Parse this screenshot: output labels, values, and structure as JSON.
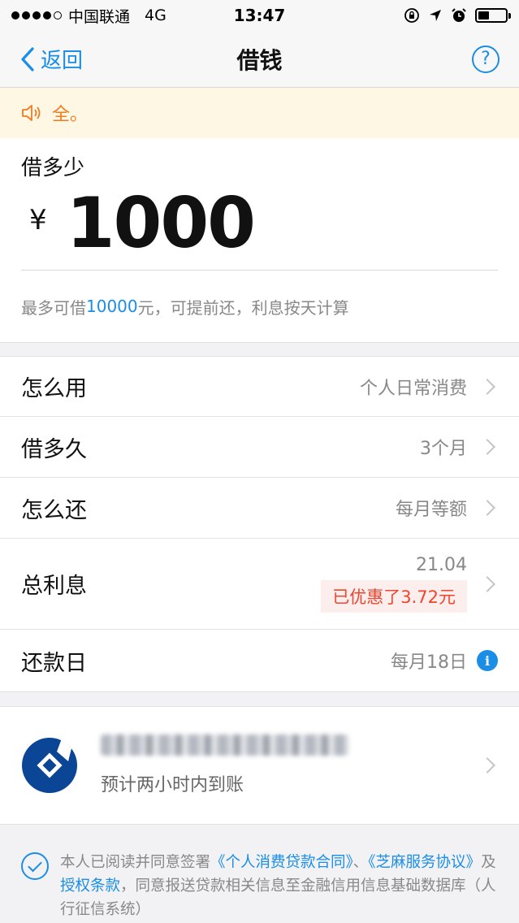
{
  "status_bar": {
    "carrier": "中国联通",
    "network": "4G",
    "time": "13:47",
    "battery_level": 0.4
  },
  "nav": {
    "back_label": "返回",
    "title": "借钱",
    "help_label": "?"
  },
  "notice": {
    "text": "全。"
  },
  "amount": {
    "label": "借多少",
    "currency": "¥",
    "value": "1000",
    "hint_prefix": "最多可借",
    "hint_max": "10000",
    "hint_suffix": "元，可提前还，利息按天计算"
  },
  "rows": [
    {
      "label": "怎么用",
      "value": "个人日常消费"
    },
    {
      "label": "借多久",
      "value": "3个月"
    },
    {
      "label": "怎么还",
      "value": "每月等额"
    },
    {
      "label": "总利息",
      "value": "21.04",
      "badge": "已优惠了3.72元"
    },
    {
      "label": "还款日",
      "value": "每月18日"
    }
  ],
  "bank": {
    "eta": "预计两小时内到账"
  },
  "agreement": {
    "text_1": "本人已阅读并同意签署",
    "link_1": "《个人消费贷款合同》",
    "text_2": "、",
    "link_2": "《芝麻服务协议》",
    "text_3": "及",
    "link_3": "授权条款",
    "text_4": "，同意报送贷款相关信息至金融信用信息基础数据库（人行征信系统）"
  },
  "colors": {
    "accent": "#1a8ee6",
    "notice": "#f07b21",
    "discount": "#f0452d",
    "bank": "#0a4596"
  }
}
